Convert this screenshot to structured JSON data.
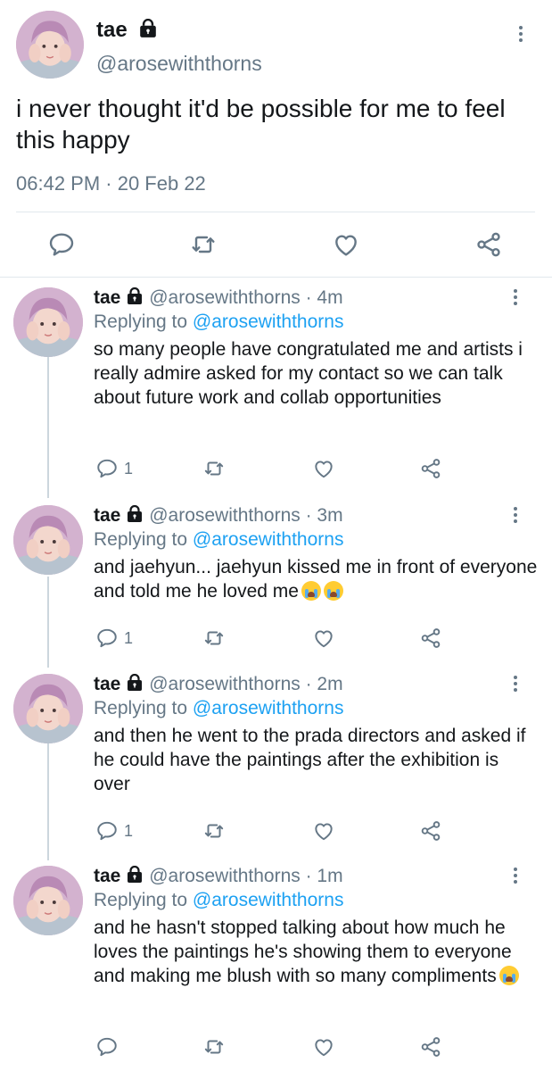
{
  "main_tweet": {
    "name": "tae",
    "handle": "@arosewiththorns",
    "text": "i never thought it'd be possible for me to feel this happy",
    "timestamp": "06:42 PM · 20 Feb 22",
    "actions": [
      "reply-icon",
      "retweet-icon",
      "like-icon",
      "share-icon"
    ]
  },
  "replies": [
    {
      "name": "tae",
      "meta": "@arosewiththorns · 4m",
      "replying_prefix": "Replying to ",
      "replying_to": "@arosewiththorns",
      "text": "so many people have congratulated me and artists i really admire asked for my contact so we can talk about future work and collab opportunities",
      "reply_count": "1",
      "emoji": ""
    },
    {
      "name": "tae",
      "meta": "@arosewiththorns · 3m",
      "replying_prefix": "Replying to ",
      "replying_to": "@arosewiththorns",
      "text": "and jaehyun... jaehyun kissed me in front of everyone and told me he loved me",
      "reply_count": "1",
      "emoji": "loudly-crying-face x2"
    },
    {
      "name": "tae",
      "meta": "@arosewiththorns · 2m",
      "replying_prefix": "Replying to ",
      "replying_to": "@arosewiththorns",
      "text": "and then he went to the prada directors and asked if he could have the paintings after the exhibition is over",
      "reply_count": "1",
      "emoji": ""
    },
    {
      "name": "tae",
      "meta": "@arosewiththorns · 1m",
      "replying_prefix": "Replying to ",
      "replying_to": "@arosewiththorns",
      "text": "and he hasn't stopped talking about how much he loves the paintings he's showing them to everyone and making me blush with so many compliments",
      "reply_count": "",
      "emoji": "loudly-crying-face"
    }
  ],
  "colors": {
    "text": "#14171a",
    "secondary": "#657786",
    "link": "#1da1f2",
    "divider": "#e1e8ed",
    "thread_line": "#ccd6dd"
  }
}
